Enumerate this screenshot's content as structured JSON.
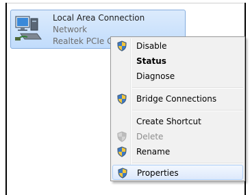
{
  "connection": {
    "name": "Local Area Connection",
    "type": "Network",
    "device": "Realtek PCIe GB",
    "icon": "network-adapter-icon"
  },
  "context_menu": {
    "items": [
      {
        "label": "Disable",
        "icon": "uac-shield-icon",
        "bold": false,
        "disabled": false
      },
      {
        "label": "Status",
        "icon": "",
        "bold": true,
        "disabled": false
      },
      {
        "label": "Diagnose",
        "icon": "",
        "bold": false,
        "disabled": false
      },
      {
        "label": "Bridge Connections",
        "icon": "uac-shield-icon",
        "bold": false,
        "disabled": false
      },
      {
        "label": "Create Shortcut",
        "icon": "",
        "bold": false,
        "disabled": false
      },
      {
        "label": "Delete",
        "icon": "uac-shield-icon",
        "bold": false,
        "disabled": true
      },
      {
        "label": "Rename",
        "icon": "uac-shield-icon",
        "bold": false,
        "disabled": false
      },
      {
        "label": "Properties",
        "icon": "uac-shield-icon",
        "bold": false,
        "disabled": false,
        "highlighted": true
      }
    ]
  },
  "colors": {
    "selection_fill": "#c1dcfc",
    "selection_border": "#84acdd",
    "menu_background": "#f1f1f1",
    "hover_border": "#aecff7",
    "disabled_text": "#8d8d8d"
  }
}
